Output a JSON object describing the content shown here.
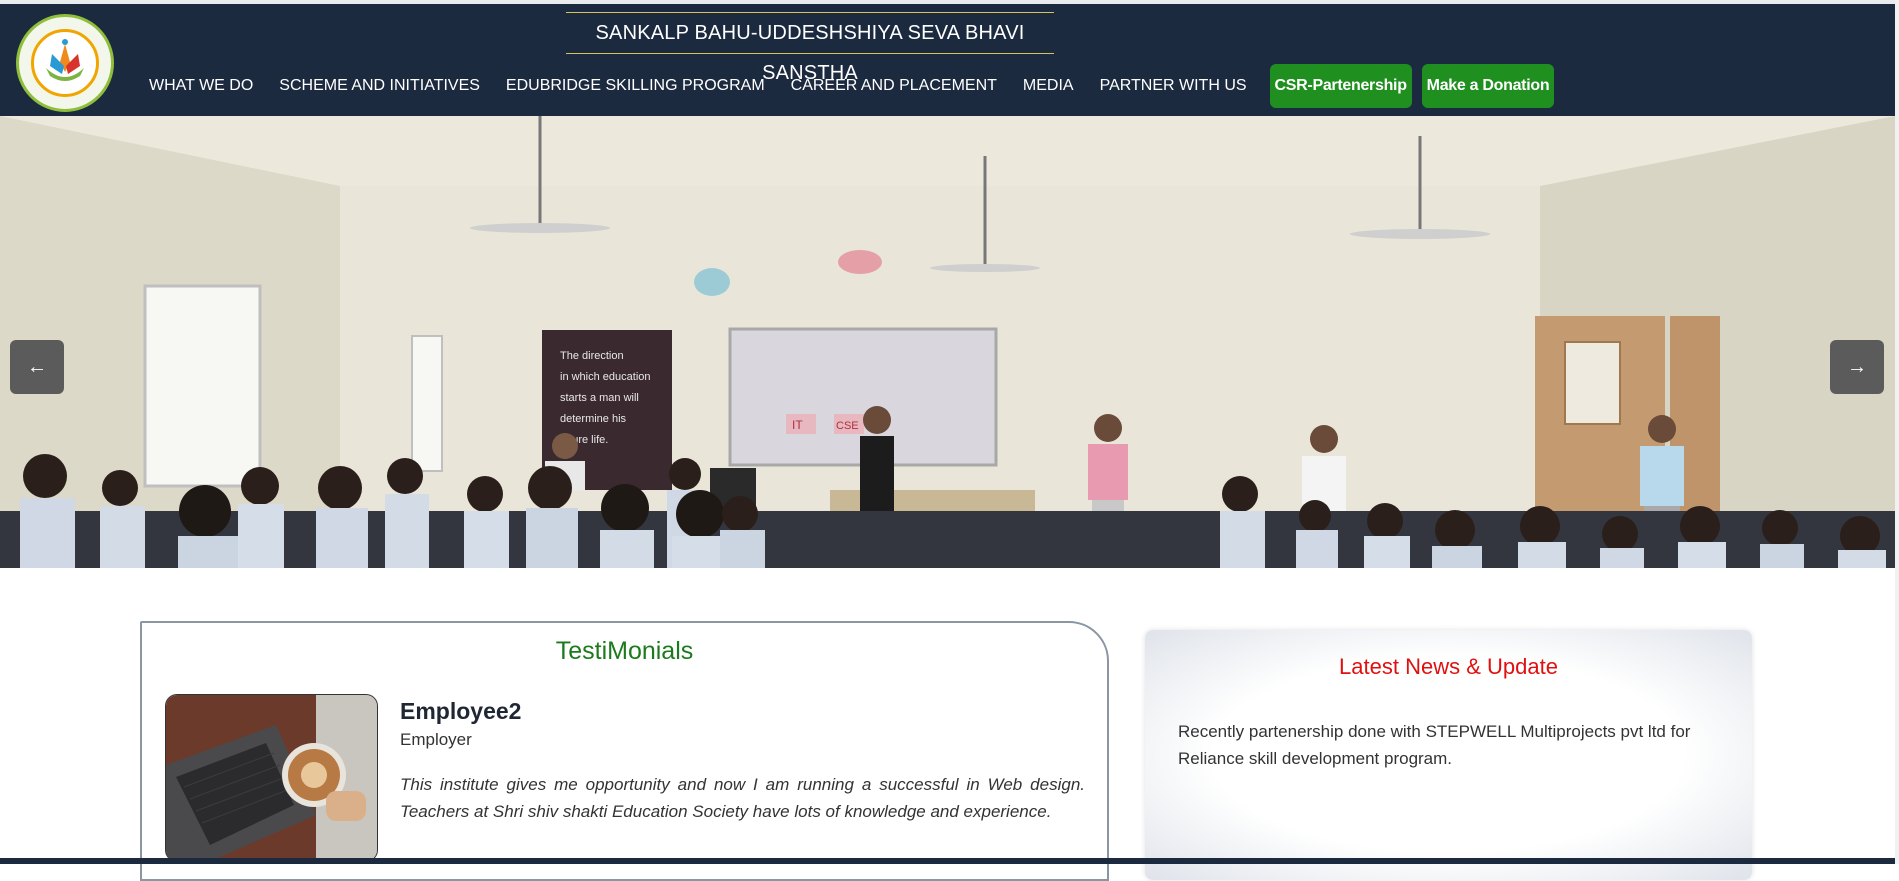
{
  "header": {
    "brand_title": "SANKALP BAHU-UDDESHSHIYA SEVA BHAVI SANSTHA",
    "nav_links": [
      "WHAT WE DO",
      "SCHEME AND INITIATIVES",
      "EDUBRIDGE SKILLING PROGRAM",
      "CAREER AND PLACEMENT",
      "MEDIA",
      "PARTNER WITH US"
    ],
    "csr_button": "CSR-Partenership",
    "donate_button": "Make a Donation"
  },
  "carousel": {
    "poster_text": [
      "The direction",
      "in which education",
      "starts a man will",
      "determine his",
      "future life."
    ],
    "whiteboard_labels": [
      "IT",
      "CSE"
    ],
    "prev_icon": "arrow-left-icon",
    "next_icon": "arrow-right-icon"
  },
  "testimonials": {
    "title": "TestiMonials",
    "name": "Employee2",
    "role": "Employer",
    "quote": "This institute gives me opportunity and now I am running a successful in Web design. Teachers at Shri shiv shakti Education Society have lots of knowledge and experience."
  },
  "news": {
    "title": "Latest News & Update",
    "text": "Recently partenership done with STEPWELL Multiprojects pvt ltd for Reliance skill development program."
  },
  "colors": {
    "navbar": "#1c2a40",
    "button_green": "#1f8f1f",
    "testimonial_title": "#1c7a1c",
    "news_title": "#e01010"
  }
}
